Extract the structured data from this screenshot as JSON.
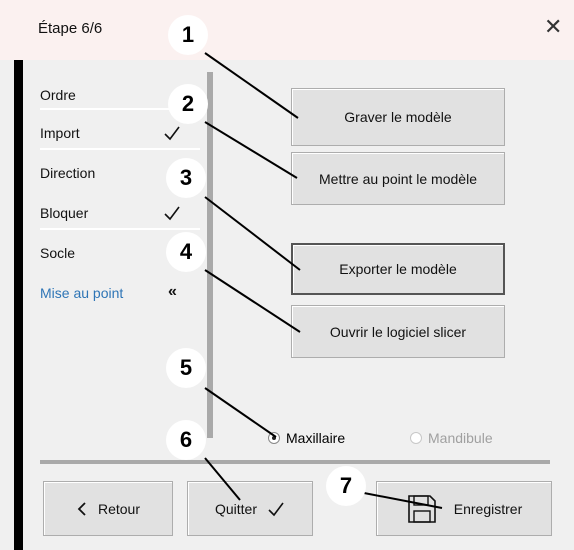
{
  "window": {
    "title": "Étape 6/6",
    "close_glyph": "✕"
  },
  "steps": [
    {
      "label": "Ordre",
      "status": "done"
    },
    {
      "label": "Import",
      "status": "done"
    },
    {
      "label": "Direction",
      "status": "done"
    },
    {
      "label": "Bloquer",
      "status": "done"
    },
    {
      "label": "Socle",
      "status": "done"
    },
    {
      "label": "Mise au point",
      "status": "current"
    }
  ],
  "actions": {
    "engrave": "Graver le modèle",
    "adjust": "Mettre au point le modèle",
    "export": "Exporter le modèle",
    "slicer": "Ouvrir le logiciel slicer"
  },
  "jaw": {
    "options": [
      "Maxillaire",
      "Mandibule"
    ],
    "selected": "Maxillaire"
  },
  "footer": {
    "back": "Retour",
    "quit": "Quitter",
    "save": "Enregistrer"
  },
  "callouts": [
    "1",
    "2",
    "3",
    "4",
    "5",
    "6",
    "7"
  ],
  "icons": {
    "back": "chevron-left-icon",
    "quit": "check-icon",
    "save": "floppy-disk-icon",
    "current_step": "double-chevron-left-icon"
  },
  "colors": {
    "active_step": "#2e75b6",
    "title_bar": "#fbf1f0"
  }
}
